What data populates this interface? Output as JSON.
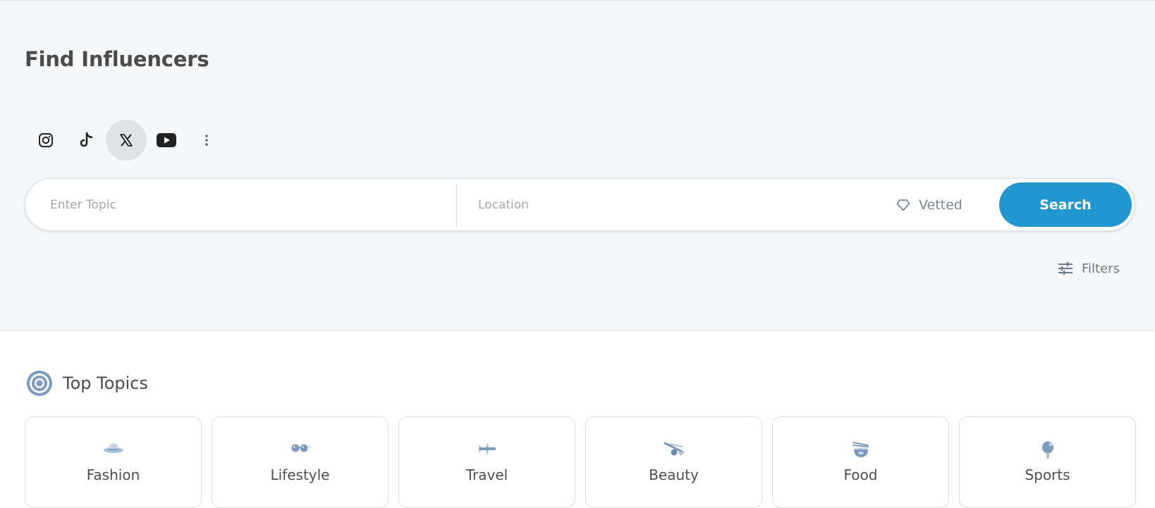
{
  "header": {
    "title": "Find Influencers"
  },
  "platforms": [
    {
      "name": "Instagram",
      "icon": "instagram-icon",
      "active": false
    },
    {
      "name": "TikTok",
      "icon": "tiktok-icon",
      "active": false
    },
    {
      "name": "X",
      "icon": "x-icon",
      "active": true
    },
    {
      "name": "YouTube",
      "icon": "youtube-icon",
      "active": false
    },
    {
      "name": "More",
      "icon": "more-vertical-icon",
      "active": false
    }
  ],
  "search": {
    "topic_placeholder": "Enter Topic",
    "topic_value": "",
    "location_placeholder": "Location",
    "location_value": "",
    "vetted_label": "Vetted",
    "search_label": "Search"
  },
  "filters": {
    "label": "Filters"
  },
  "top_topics": {
    "title": "Top Topics",
    "items": [
      {
        "label": "Fashion",
        "icon": "hat-icon"
      },
      {
        "label": "Lifestyle",
        "icon": "sunglasses-icon"
      },
      {
        "label": "Travel",
        "icon": "airplane-icon"
      },
      {
        "label": "Beauty",
        "icon": "makeup-brush-icon"
      },
      {
        "label": "Food",
        "icon": "noodle-bowl-icon"
      },
      {
        "label": "Sports",
        "icon": "ping-pong-paddle-icon"
      }
    ]
  },
  "colors": {
    "accent": "#2196cf",
    "hero_bg": "#f6f7f9",
    "topic_icon": "#7a9bbd",
    "muted_text": "#7c8796"
  }
}
